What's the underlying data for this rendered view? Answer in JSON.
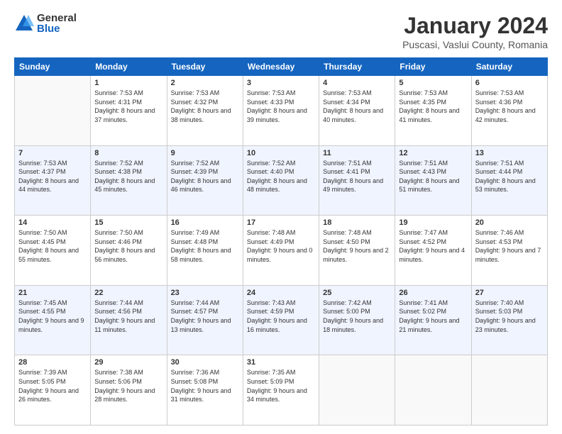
{
  "logo": {
    "general": "General",
    "blue": "Blue"
  },
  "title": "January 2024",
  "subtitle": "Puscasi, Vaslui County, Romania",
  "headers": [
    "Sunday",
    "Monday",
    "Tuesday",
    "Wednesday",
    "Thursday",
    "Friday",
    "Saturday"
  ],
  "weeks": [
    [
      {
        "day": "",
        "sunrise": "",
        "sunset": "",
        "daylight": ""
      },
      {
        "day": "1",
        "sunrise": "Sunrise: 7:53 AM",
        "sunset": "Sunset: 4:31 PM",
        "daylight": "Daylight: 8 hours and 37 minutes."
      },
      {
        "day": "2",
        "sunrise": "Sunrise: 7:53 AM",
        "sunset": "Sunset: 4:32 PM",
        "daylight": "Daylight: 8 hours and 38 minutes."
      },
      {
        "day": "3",
        "sunrise": "Sunrise: 7:53 AM",
        "sunset": "Sunset: 4:33 PM",
        "daylight": "Daylight: 8 hours and 39 minutes."
      },
      {
        "day": "4",
        "sunrise": "Sunrise: 7:53 AM",
        "sunset": "Sunset: 4:34 PM",
        "daylight": "Daylight: 8 hours and 40 minutes."
      },
      {
        "day": "5",
        "sunrise": "Sunrise: 7:53 AM",
        "sunset": "Sunset: 4:35 PM",
        "daylight": "Daylight: 8 hours and 41 minutes."
      },
      {
        "day": "6",
        "sunrise": "Sunrise: 7:53 AM",
        "sunset": "Sunset: 4:36 PM",
        "daylight": "Daylight: 8 hours and 42 minutes."
      }
    ],
    [
      {
        "day": "7",
        "sunrise": "Sunrise: 7:53 AM",
        "sunset": "Sunset: 4:37 PM",
        "daylight": "Daylight: 8 hours and 44 minutes."
      },
      {
        "day": "8",
        "sunrise": "Sunrise: 7:52 AM",
        "sunset": "Sunset: 4:38 PM",
        "daylight": "Daylight: 8 hours and 45 minutes."
      },
      {
        "day": "9",
        "sunrise": "Sunrise: 7:52 AM",
        "sunset": "Sunset: 4:39 PM",
        "daylight": "Daylight: 8 hours and 46 minutes."
      },
      {
        "day": "10",
        "sunrise": "Sunrise: 7:52 AM",
        "sunset": "Sunset: 4:40 PM",
        "daylight": "Daylight: 8 hours and 48 minutes."
      },
      {
        "day": "11",
        "sunrise": "Sunrise: 7:51 AM",
        "sunset": "Sunset: 4:41 PM",
        "daylight": "Daylight: 8 hours and 49 minutes."
      },
      {
        "day": "12",
        "sunrise": "Sunrise: 7:51 AM",
        "sunset": "Sunset: 4:43 PM",
        "daylight": "Daylight: 8 hours and 51 minutes."
      },
      {
        "day": "13",
        "sunrise": "Sunrise: 7:51 AM",
        "sunset": "Sunset: 4:44 PM",
        "daylight": "Daylight: 8 hours and 53 minutes."
      }
    ],
    [
      {
        "day": "14",
        "sunrise": "Sunrise: 7:50 AM",
        "sunset": "Sunset: 4:45 PM",
        "daylight": "Daylight: 8 hours and 55 minutes."
      },
      {
        "day": "15",
        "sunrise": "Sunrise: 7:50 AM",
        "sunset": "Sunset: 4:46 PM",
        "daylight": "Daylight: 8 hours and 56 minutes."
      },
      {
        "day": "16",
        "sunrise": "Sunrise: 7:49 AM",
        "sunset": "Sunset: 4:48 PM",
        "daylight": "Daylight: 8 hours and 58 minutes."
      },
      {
        "day": "17",
        "sunrise": "Sunrise: 7:48 AM",
        "sunset": "Sunset: 4:49 PM",
        "daylight": "Daylight: 9 hours and 0 minutes."
      },
      {
        "day": "18",
        "sunrise": "Sunrise: 7:48 AM",
        "sunset": "Sunset: 4:50 PM",
        "daylight": "Daylight: 9 hours and 2 minutes."
      },
      {
        "day": "19",
        "sunrise": "Sunrise: 7:47 AM",
        "sunset": "Sunset: 4:52 PM",
        "daylight": "Daylight: 9 hours and 4 minutes."
      },
      {
        "day": "20",
        "sunrise": "Sunrise: 7:46 AM",
        "sunset": "Sunset: 4:53 PM",
        "daylight": "Daylight: 9 hours and 7 minutes."
      }
    ],
    [
      {
        "day": "21",
        "sunrise": "Sunrise: 7:45 AM",
        "sunset": "Sunset: 4:55 PM",
        "daylight": "Daylight: 9 hours and 9 minutes."
      },
      {
        "day": "22",
        "sunrise": "Sunrise: 7:44 AM",
        "sunset": "Sunset: 4:56 PM",
        "daylight": "Daylight: 9 hours and 11 minutes."
      },
      {
        "day": "23",
        "sunrise": "Sunrise: 7:44 AM",
        "sunset": "Sunset: 4:57 PM",
        "daylight": "Daylight: 9 hours and 13 minutes."
      },
      {
        "day": "24",
        "sunrise": "Sunrise: 7:43 AM",
        "sunset": "Sunset: 4:59 PM",
        "daylight": "Daylight: 9 hours and 16 minutes."
      },
      {
        "day": "25",
        "sunrise": "Sunrise: 7:42 AM",
        "sunset": "Sunset: 5:00 PM",
        "daylight": "Daylight: 9 hours and 18 minutes."
      },
      {
        "day": "26",
        "sunrise": "Sunrise: 7:41 AM",
        "sunset": "Sunset: 5:02 PM",
        "daylight": "Daylight: 9 hours and 21 minutes."
      },
      {
        "day": "27",
        "sunrise": "Sunrise: 7:40 AM",
        "sunset": "Sunset: 5:03 PM",
        "daylight": "Daylight: 9 hours and 23 minutes."
      }
    ],
    [
      {
        "day": "28",
        "sunrise": "Sunrise: 7:39 AM",
        "sunset": "Sunset: 5:05 PM",
        "daylight": "Daylight: 9 hours and 26 minutes."
      },
      {
        "day": "29",
        "sunrise": "Sunrise: 7:38 AM",
        "sunset": "Sunset: 5:06 PM",
        "daylight": "Daylight: 9 hours and 28 minutes."
      },
      {
        "day": "30",
        "sunrise": "Sunrise: 7:36 AM",
        "sunset": "Sunset: 5:08 PM",
        "daylight": "Daylight: 9 hours and 31 minutes."
      },
      {
        "day": "31",
        "sunrise": "Sunrise: 7:35 AM",
        "sunset": "Sunset: 5:09 PM",
        "daylight": "Daylight: 9 hours and 34 minutes."
      },
      {
        "day": "",
        "sunrise": "",
        "sunset": "",
        "daylight": ""
      },
      {
        "day": "",
        "sunrise": "",
        "sunset": "",
        "daylight": ""
      },
      {
        "day": "",
        "sunrise": "",
        "sunset": "",
        "daylight": ""
      }
    ]
  ]
}
